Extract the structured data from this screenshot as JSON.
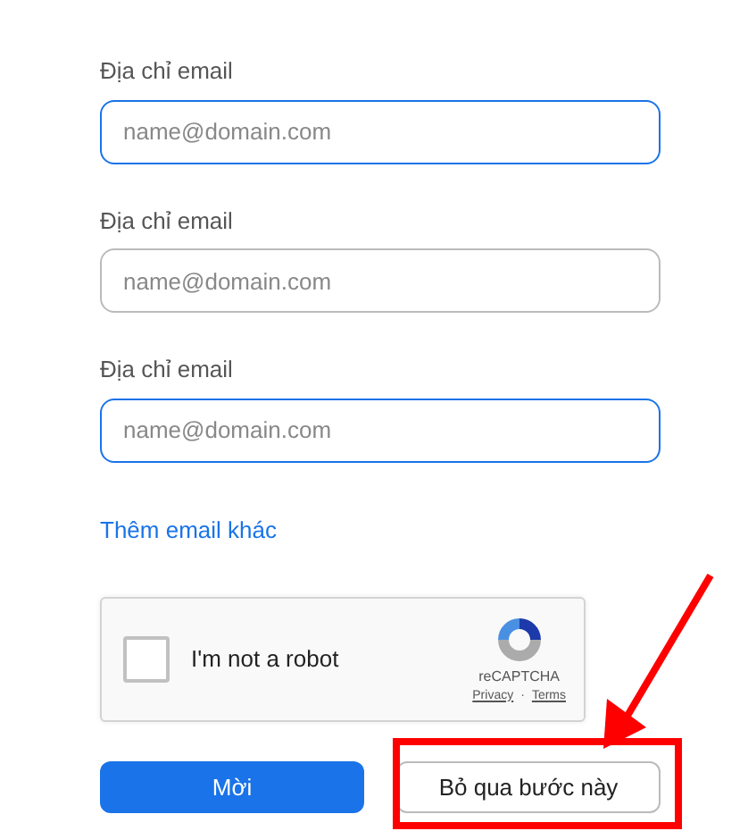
{
  "email_fields": [
    {
      "label": "Địa chỉ email",
      "placeholder": "name@domain.com",
      "highlighted": true
    },
    {
      "label": "Địa chỉ email",
      "placeholder": "name@domain.com",
      "highlighted": false
    },
    {
      "label": "Địa chỉ email",
      "placeholder": "name@domain.com",
      "highlighted": true
    }
  ],
  "add_link": "Thêm email khác",
  "captcha": {
    "label": "I'm not a robot",
    "checked": false,
    "brand": "reCAPTCHA",
    "privacy": "Privacy",
    "separator": "·",
    "terms": "Terms"
  },
  "buttons": [
    {
      "label": "Mời",
      "kind": "primary",
      "annotated": false
    },
    {
      "label": "Bỏ qua bước này",
      "kind": "secondary",
      "annotated": true
    }
  ]
}
